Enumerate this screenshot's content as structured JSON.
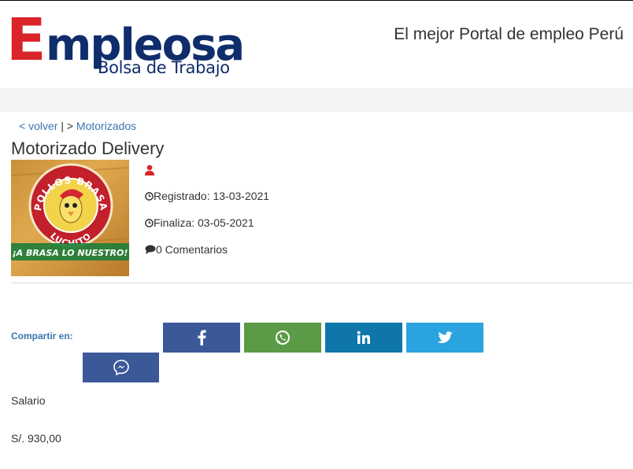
{
  "brand": {
    "logo_first_letter": "E",
    "logo_rest": "mpleosa",
    "logo_sub": "Bolsa de Trabajo",
    "tagline": "El mejor Portal de empleo Perú",
    "colors": {
      "red": "#d9242a",
      "navy": "#0f2d6b"
    }
  },
  "breadcrumb": {
    "back_link": "< volver",
    "separator": "| >",
    "category_link": "Motorizados"
  },
  "job": {
    "title": "Motorizado Delivery",
    "company_logo": {
      "line_top": "POLLOS BRASA",
      "line_bottom": "LUCHITO",
      "slogan": "¡A BRASA LO NUESTRO!"
    },
    "registered": "Registrado: 13-03-2021",
    "ends": "Finaliza: 03-05-2021",
    "comments": "0 Comentarios"
  },
  "share": {
    "label": "Compartir en:",
    "buttons": [
      {
        "name": "facebook-icon",
        "color": "#3b5998"
      },
      {
        "name": "whatsapp-icon",
        "color": "#5b9a46"
      },
      {
        "name": "linkedin-icon",
        "color": "#0e76a8"
      },
      {
        "name": "twitter-icon",
        "color": "#2aa3de"
      },
      {
        "name": "messenger-icon",
        "color": "#3b5998"
      }
    ]
  },
  "salary": {
    "label": "Salario",
    "value": "S/. 930,00"
  }
}
